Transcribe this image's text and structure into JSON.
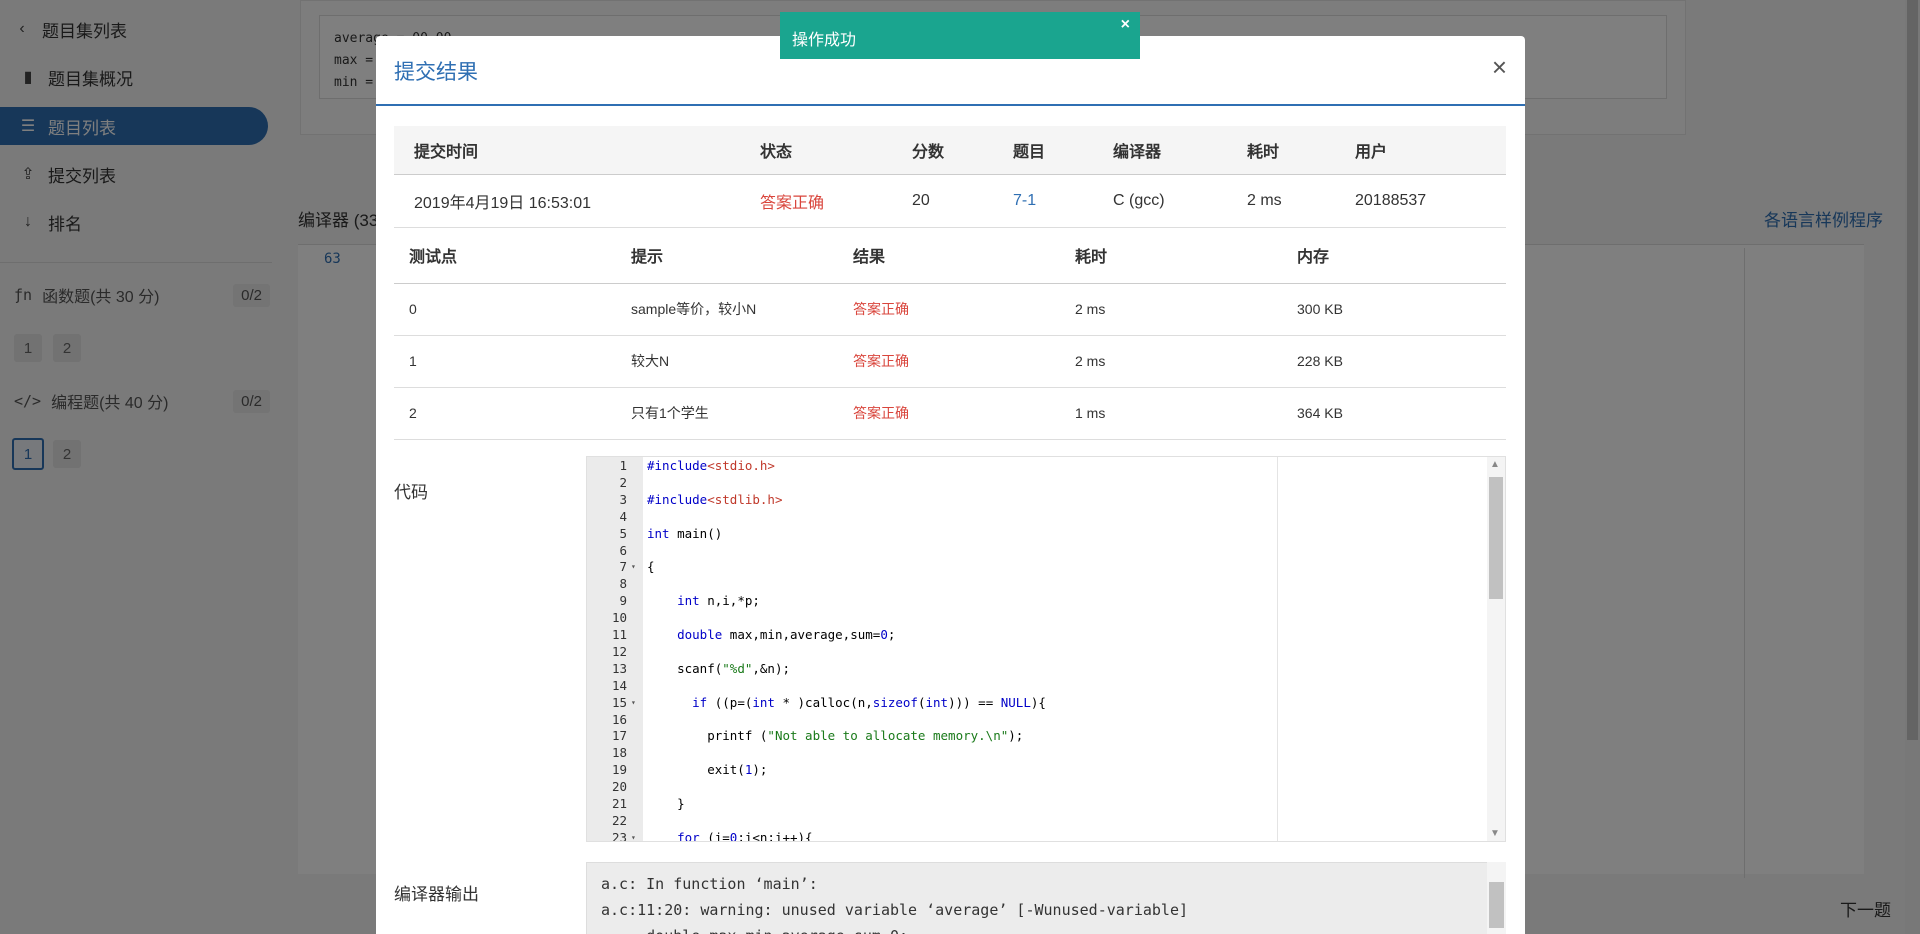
{
  "sidebar": {
    "back_label": "题目集列表",
    "overview_label": "题目集概况",
    "problem_list_label": "题目列表",
    "submission_list_label": "提交列表",
    "rank_label": "排名",
    "group1": {
      "label": "函数题(共 30 分)",
      "count": "0/2",
      "pages": [
        "1",
        "2"
      ]
    },
    "group2": {
      "label": "编程题(共 40 分)",
      "count": "0/2",
      "pages": [
        "1",
        "2"
      ]
    }
  },
  "background": {
    "sample_lines": "average = 00.00\nmax = \nmin = ",
    "compiler_label": "编译器 (33",
    "samples_link": "各语言样例程序",
    "editor_line_number": "63",
    "next_label": "下一题"
  },
  "toast": {
    "message": "操作成功",
    "close": "×"
  },
  "modal": {
    "title": "提交结果",
    "close": "×",
    "summary_headers": [
      "提交时间",
      "状态",
      "分数",
      "题目",
      "编译器",
      "耗时",
      "用户"
    ],
    "summary_row": [
      "2019年4月19日 16:53:01",
      "答案正确",
      "20",
      "7-1",
      "C (gcc)",
      "2 ms",
      "20188537"
    ],
    "test_headers": [
      "测试点",
      "提示",
      "结果",
      "耗时",
      "内存"
    ],
    "test_rows": [
      [
        "0",
        "sample等价，较小N",
        "答案正确",
        "2 ms",
        "300 KB"
      ],
      [
        "1",
        "较大N",
        "答案正确",
        "2 ms",
        "228 KB"
      ],
      [
        "2",
        "只有1个学生",
        "答案正确",
        "1 ms",
        "364 KB"
      ]
    ],
    "code_label": "代码",
    "code_lines": [
      {
        "n": "1",
        "fold": "",
        "html": "<span class=\"kw\">#include</span><span class=\"inc\">&lt;stdio.h&gt;</span>"
      },
      {
        "n": "2",
        "fold": "",
        "html": ""
      },
      {
        "n": "3",
        "fold": "",
        "html": "<span class=\"kw\">#include</span><span class=\"inc\">&lt;stdlib.h&gt;</span>"
      },
      {
        "n": "4",
        "fold": "",
        "html": ""
      },
      {
        "n": "5",
        "fold": "",
        "html": "<span class=\"kw\">int</span> main()"
      },
      {
        "n": "6",
        "fold": "",
        "html": ""
      },
      {
        "n": "7",
        "fold": "▾",
        "html": "{"
      },
      {
        "n": "8",
        "fold": "",
        "html": ""
      },
      {
        "n": "9",
        "fold": "",
        "html": "    <span class=\"kw\">int</span> n,i,*p;"
      },
      {
        "n": "10",
        "fold": "",
        "html": ""
      },
      {
        "n": "11",
        "fold": "",
        "html": "    <span class=\"kw\">double</span> max,min,average,sum=<span class=\"numc\">0</span>;"
      },
      {
        "n": "12",
        "fold": "",
        "html": ""
      },
      {
        "n": "13",
        "fold": "",
        "html": "    scanf(<span class=\"str\">\"%d\"</span>,&amp;n);"
      },
      {
        "n": "14",
        "fold": "",
        "html": ""
      },
      {
        "n": "15",
        "fold": "▾",
        "html": "      <span class=\"kw\">if</span> ((p=(<span class=\"kw\">int</span> * )calloc(n,<span class=\"kw\">sizeof</span>(<span class=\"kw\">int</span>))) == <span class=\"kw\">NULL</span>){"
      },
      {
        "n": "16",
        "fold": "",
        "html": ""
      },
      {
        "n": "17",
        "fold": "",
        "html": "        printf (<span class=\"str\">\"Not able to allocate memory.\\n\"</span>);"
      },
      {
        "n": "18",
        "fold": "",
        "html": ""
      },
      {
        "n": "19",
        "fold": "",
        "html": "        exit(<span class=\"numc\">1</span>);"
      },
      {
        "n": "20",
        "fold": "",
        "html": ""
      },
      {
        "n": "21",
        "fold": "",
        "html": "    }"
      },
      {
        "n": "22",
        "fold": "",
        "html": ""
      },
      {
        "n": "23",
        "fold": "▾",
        "html": "    <span class=\"kw\">for</span> (i=<span class=\"numc\">0</span>;i&lt;n;i++){"
      }
    ],
    "compiler_output_label": "编译器输出",
    "compiler_output": "a.c: In function ‘main’:\na.c:11:20: warning: unused variable ‘average’ [-Wunused-variable]\n     double max,min,average,sum=0;"
  }
}
